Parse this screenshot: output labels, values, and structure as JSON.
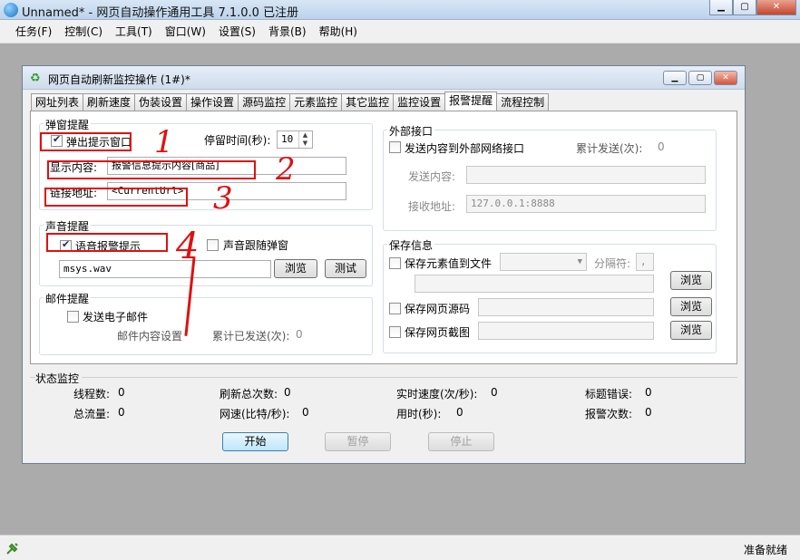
{
  "app": {
    "title": "Unnamed* - 网页自动操作通用工具 7.1.0.0  已注册"
  },
  "menu": [
    "任务(F)",
    "控制(C)",
    "工具(T)",
    "窗口(W)",
    "设置(S)",
    "背景(B)",
    "帮助(H)"
  ],
  "child_window": {
    "title": "网页自动刷新监控操作  (1#)*"
  },
  "tabs": [
    "网址列表",
    "刷新速度",
    "伪装设置",
    "操作设置",
    "源码监控",
    "元素监控",
    "其它监控",
    "监控设置",
    "报警提醒",
    "流程控制"
  ],
  "active_tab": "报警提醒",
  "popup": {
    "group_title": "弹窗提醒",
    "show_popup_label": "弹出提示窗口",
    "show_popup_checked": true,
    "stay_time_label": "停留时间(秒):",
    "stay_time_value": "10",
    "content_label": "显示内容:",
    "content_value": "报警信息提示内容[商品]",
    "link_label": "链接地址:",
    "link_value": "<CurrentUrl>"
  },
  "sound": {
    "group_title": "声音提醒",
    "voice_label": "语音报警提示",
    "voice_checked": true,
    "follow_label": "声音跟随弹窗",
    "follow_checked": false,
    "file_value": "msys.wav",
    "browse_label": "浏览",
    "test_label": "测试"
  },
  "mail": {
    "group_title": "邮件提醒",
    "send_label": "发送电子邮件",
    "send_checked": false,
    "content_settings": "邮件内容设置",
    "sent_count_label": "累计已发送(次):",
    "sent_count_value": "0"
  },
  "external": {
    "group_title": "外部接口",
    "send_label": "发送内容到外部网络接口",
    "send_checked": false,
    "total_label": "累计发送(次):",
    "total_value": "0",
    "content_label": "发送内容:",
    "content_value": "",
    "receive_label": "接收地址:",
    "receive_value": "127.0.0.1:8888"
  },
  "save": {
    "group_title": "保存信息",
    "save_element_label": "保存元素值到文件",
    "separator_label": "分隔符:",
    "separator_value": ",",
    "browse_label": "浏览",
    "save_source_label": "保存网页源码",
    "save_screenshot_label": "保存网页截图"
  },
  "status": {
    "group_title": "状态监控",
    "items": [
      {
        "label": "线程数:",
        "value": "0"
      },
      {
        "label": "刷新总次数:",
        "value": "0"
      },
      {
        "label": "实时速度(次/秒):",
        "value": "0"
      },
      {
        "label": "标题错误:",
        "value": "0"
      },
      {
        "label": "总流量:",
        "value": "0"
      },
      {
        "label": "网速(比特/秒):",
        "value": "0"
      },
      {
        "label": "用时(秒):",
        "value": "0"
      },
      {
        "label": "报警次数:",
        "value": "0"
      }
    ],
    "start_label": "开始",
    "pause_label": "暂停",
    "stop_label": "停止"
  },
  "annotations": [
    "1",
    "2",
    "3",
    "4"
  ],
  "statusbar": {
    "text": "准备就绪"
  },
  "colors": {
    "annotation": "#e01010",
    "desktop": "#ababab"
  }
}
